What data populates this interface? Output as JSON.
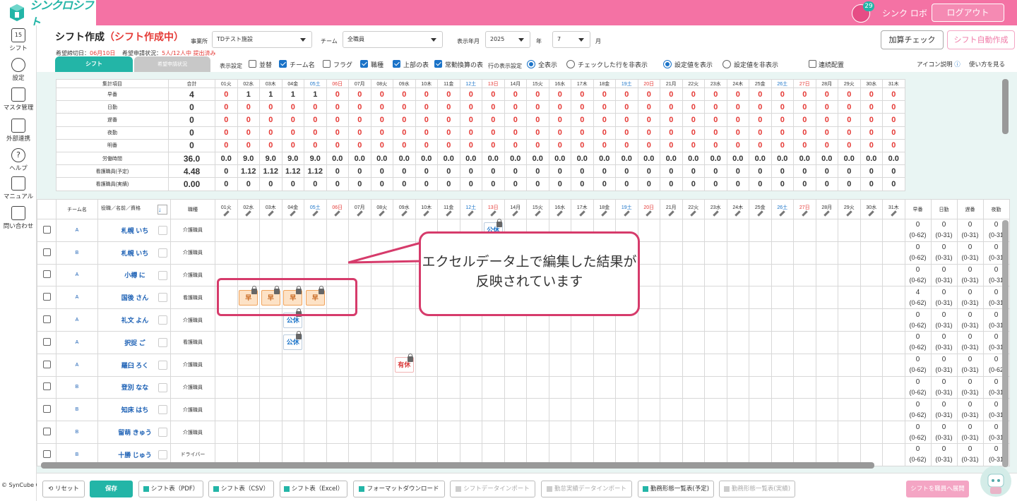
{
  "app": {
    "logo_text": "シンクロシフト",
    "user_name": "シンク ロボ",
    "logout": "ログアウト",
    "calendar_day": "15",
    "calendar_badge": "29"
  },
  "sidebar": [
    {
      "label": "シフト",
      "icon": "calendar-icon"
    },
    {
      "label": "設定",
      "icon": "gear-icon"
    },
    {
      "label": "マスタ管理",
      "icon": "database-icon"
    },
    {
      "label": "外部連携",
      "icon": "cloud-icon"
    },
    {
      "label": "ヘルプ",
      "icon": "help-icon"
    },
    {
      "label": "マニュアル",
      "icon": "manual-icon"
    },
    {
      "label": "問い合わせ",
      "icon": "mail-icon"
    }
  ],
  "copyright": "© SynCube Co., Ltd.",
  "page": {
    "title": "シフト作成",
    "status": "（シフト作成中）",
    "deadline_label": "希望締切日：",
    "deadline": "06月10日",
    "request_label": "希望申請状況：",
    "request_status": "5人/12人中 提出済み"
  },
  "filters": {
    "office_label": "事業所",
    "office": "TDテスト施設",
    "team_label": "チーム",
    "team": "全職員",
    "ym_label": "表示年月",
    "year": "2025",
    "year_unit": "年",
    "month": "7",
    "month_unit": "月"
  },
  "buttons_top": {
    "calc_check": "加算チェック",
    "auto_create": "シフト自動作成"
  },
  "tabs": {
    "shift": "シフト",
    "request": "希望申請状況"
  },
  "display": {
    "label": "表示設定",
    "opts": [
      {
        "label": "並替",
        "on": false
      },
      {
        "label": "チーム名",
        "on": true
      },
      {
        "label": "フラグ",
        "on": false
      },
      {
        "label": "職種",
        "on": true
      },
      {
        "label": "上部の表",
        "on": true
      },
      {
        "label": "常勤換算の表",
        "on": true
      }
    ],
    "row_label": "行の表示設定",
    "row_opts": [
      {
        "label": "全表示",
        "on": true
      },
      {
        "label": "チェックした行を非表示",
        "on": false
      }
    ],
    "val_opts": [
      {
        "label": "設定値を表示",
        "on": true
      },
      {
        "label": "設定値を非表示",
        "on": false
      }
    ],
    "consecutive": "連続配置",
    "icon_help": "アイコン説明",
    "how_to": "使い方を見る"
  },
  "days": [
    "01火",
    "02水",
    "03木",
    "04金",
    "05土",
    "06日",
    "07月",
    "08火",
    "09水",
    "10木",
    "11金",
    "12土",
    "13日",
    "14月",
    "15火",
    "16水",
    "17木",
    "18金",
    "19土",
    "20日",
    "21月",
    "22火",
    "23水",
    "24木",
    "25金",
    "26土",
    "27日",
    "28月",
    "29火",
    "30水",
    "31木"
  ],
  "summary": {
    "header_name": "集計項目",
    "header_total": "合計",
    "rows": [
      {
        "name": "早番",
        "total": "4",
        "vals": [
          "0",
          "1",
          "1",
          "1",
          "1",
          "0",
          "0",
          "0",
          "0",
          "0",
          "0",
          "0",
          "0",
          "0",
          "0",
          "0",
          "0",
          "0",
          "0",
          "0",
          "0",
          "0",
          "0",
          "0",
          "0",
          "0",
          "0",
          "0",
          "0",
          "0",
          "0"
        ],
        "red": true
      },
      {
        "name": "日勤",
        "total": "0",
        "vals": [
          "0",
          "0",
          "0",
          "0",
          "0",
          "0",
          "0",
          "0",
          "0",
          "0",
          "0",
          "0",
          "0",
          "0",
          "0",
          "0",
          "0",
          "0",
          "0",
          "0",
          "0",
          "0",
          "0",
          "0",
          "0",
          "0",
          "0",
          "0",
          "0",
          "0",
          "0"
        ],
        "red": true
      },
      {
        "name": "遅番",
        "total": "0",
        "vals": [
          "0",
          "0",
          "0",
          "0",
          "0",
          "0",
          "0",
          "0",
          "0",
          "0",
          "0",
          "0",
          "0",
          "0",
          "0",
          "0",
          "0",
          "0",
          "0",
          "0",
          "0",
          "0",
          "0",
          "0",
          "0",
          "0",
          "0",
          "0",
          "0",
          "0",
          "0"
        ],
        "red": true
      },
      {
        "name": "夜勤",
        "total": "0",
        "vals": [
          "0",
          "0",
          "0",
          "0",
          "0",
          "0",
          "0",
          "0",
          "0",
          "0",
          "0",
          "0",
          "0",
          "0",
          "0",
          "0",
          "0",
          "0",
          "0",
          "0",
          "0",
          "0",
          "0",
          "0",
          "0",
          "0",
          "0",
          "0",
          "0",
          "0",
          "0"
        ],
        "red": true
      },
      {
        "name": "明番",
        "total": "0",
        "vals": [
          "0",
          "0",
          "0",
          "0",
          "0",
          "0",
          "0",
          "0",
          "0",
          "0",
          "0",
          "0",
          "0",
          "0",
          "0",
          "0",
          "0",
          "0",
          "0",
          "0",
          "0",
          "0",
          "0",
          "0",
          "0",
          "0",
          "0",
          "0",
          "0",
          "0",
          "0"
        ],
        "red": true
      },
      {
        "name": "労働時間",
        "total": "36.0",
        "vals": [
          "0.0",
          "9.0",
          "9.0",
          "9.0",
          "9.0",
          "0.0",
          "0.0",
          "0.0",
          "0.0",
          "0.0",
          "0.0",
          "0.0",
          "0.0",
          "0.0",
          "0.0",
          "0.0",
          "0.0",
          "0.0",
          "0.0",
          "0.0",
          "0.0",
          "0.0",
          "0.0",
          "0.0",
          "0.0",
          "0.0",
          "0.0",
          "0.0",
          "0.0",
          "0.0",
          "0.0"
        ],
        "red": false
      },
      {
        "name": "看護職員(予定)",
        "total": "4.48",
        "vals": [
          "0",
          "1.12",
          "1.12",
          "1.12",
          "1.12",
          "0",
          "0",
          "0",
          "0",
          "0",
          "0",
          "0",
          "0",
          "0",
          "0",
          "0",
          "0",
          "0",
          "0",
          "0",
          "0",
          "0",
          "0",
          "0",
          "0",
          "0",
          "0",
          "0",
          "0",
          "0",
          "0"
        ],
        "red": false
      },
      {
        "name": "看護職員(実績)",
        "total": "0.00",
        "vals": [
          "0",
          "0",
          "0",
          "0",
          "0",
          "0",
          "0",
          "0",
          "0",
          "0",
          "0",
          "0",
          "0",
          "0",
          "0",
          "0",
          "0",
          "0",
          "0",
          "0",
          "0",
          "0",
          "0",
          "0",
          "0",
          "0",
          "0",
          "0",
          "0",
          "0",
          "0"
        ],
        "red": false
      }
    ]
  },
  "grid": {
    "h_team": "チーム名",
    "h_name": "役職／名前／資格",
    "h_job": "職種",
    "right_heads": [
      "早番",
      "日勤",
      "遅番",
      "夜勤"
    ],
    "staff": [
      {
        "team": "A",
        "name": "札幌 いち",
        "job": "介護職員",
        "shifts": {
          "13": "公休"
        },
        "r": [
          [
            "0",
            "(0-62)"
          ],
          [
            "0",
            "(0-31)"
          ],
          [
            "0",
            "(0-31)"
          ],
          [
            "0",
            "(0-31"
          ]
        ]
      },
      {
        "team": "B",
        "name": "札幌 いち",
        "job": "介護職員",
        "shifts": {},
        "r": [
          [
            "0",
            "(0-62)"
          ],
          [
            "0",
            "(0-31)"
          ],
          [
            "0",
            "(0-31)"
          ],
          [
            "0",
            "(0-31"
          ]
        ]
      },
      {
        "team": "A",
        "name": "小樽 に",
        "job": "介護職員",
        "shifts": {},
        "r": [
          [
            "0",
            "(0-62)"
          ],
          [
            "0",
            "(0-31)"
          ],
          [
            "0",
            "(0-31)"
          ],
          [
            "0",
            "(0-31"
          ]
        ]
      },
      {
        "team": "A",
        "name": "国後 さん",
        "job": "看護職員",
        "shifts": {
          "02": "早",
          "03": "早",
          "04": "早",
          "05": "早"
        },
        "r": [
          [
            "4",
            "(0-62)"
          ],
          [
            "0",
            "(0-31)"
          ],
          [
            "0",
            "(0-31)"
          ],
          [
            "0",
            "(0-31"
          ]
        ]
      },
      {
        "team": "A",
        "name": "礼文 よん",
        "job": "介護職員",
        "shifts": {
          "04": "公休"
        },
        "r": [
          [
            "0",
            "(0-62)"
          ],
          [
            "0",
            "(0-31)"
          ],
          [
            "0",
            "(0-31)"
          ],
          [
            "0",
            "(0-31"
          ]
        ]
      },
      {
        "team": "A",
        "name": "択捉 ご",
        "job": "看護職員",
        "shifts": {
          "04": "公休"
        },
        "r": [
          [
            "0",
            "(0-62)"
          ],
          [
            "0",
            "(0-31)"
          ],
          [
            "0",
            "(0-31)"
          ],
          [
            "0",
            "(0-31"
          ]
        ]
      },
      {
        "team": "A",
        "name": "羅臼 ろく",
        "job": "介護職員",
        "shifts": {
          "09": "有休"
        },
        "r": [
          [
            "0",
            "(0-62)"
          ],
          [
            "0",
            "(0-31)"
          ],
          [
            "0",
            "(0-31)"
          ],
          [
            "0",
            "(0-62"
          ]
        ]
      },
      {
        "team": "B",
        "name": "登別 なな",
        "job": "介護職員",
        "shifts": {},
        "r": [
          [
            "0",
            "(0-62)"
          ],
          [
            "0",
            "(0-31)"
          ],
          [
            "0",
            "(0-31)"
          ],
          [
            "0",
            "(0-31"
          ]
        ]
      },
      {
        "team": "B",
        "name": "知床 はち",
        "job": "介護職員",
        "shifts": {},
        "r": [
          [
            "0",
            "(0-62)"
          ],
          [
            "0",
            "(0-31)"
          ],
          [
            "0",
            "(0-31)"
          ],
          [
            "0",
            "(0-31"
          ]
        ]
      },
      {
        "team": "B",
        "name": "留萌 きゅう",
        "job": "介護職員",
        "shifts": {},
        "r": [
          [
            "0",
            "(0-62)"
          ],
          [
            "0",
            "(0-31)"
          ],
          [
            "0",
            "(0-31)"
          ],
          [
            "0",
            "(0-31"
          ]
        ]
      },
      {
        "team": "B",
        "name": "十勝 じゅう",
        "job": "ドライバー",
        "shifts": {},
        "r": [
          [
            "0",
            "(0-62)"
          ],
          [
            "0",
            "(0-31)"
          ],
          [
            "0",
            "(0-31)"
          ],
          [
            "0",
            "(0-31"
          ]
        ]
      }
    ]
  },
  "callout": "エクセルデータ上で編集した結果が反映されています",
  "bottom": {
    "reset": "リセット",
    "save": "保存",
    "pdf": "シフト表（PDF）",
    "csv": "シフト表（CSV）",
    "excel": "シフト表（Excel）",
    "format": "フォーマットダウンロード",
    "import": "シフトデータインポート",
    "actual_import": "勤怠実績データインポート",
    "plan_list": "勤務形態一覧表(予定)",
    "actual_list": "勤務形態一覧表(実績)",
    "deploy": "シフトを職員へ展開"
  },
  "colors": {
    "accent": "#23b5a7",
    "header_pink": "#f472a4",
    "callout_border": "#d63b6b"
  }
}
